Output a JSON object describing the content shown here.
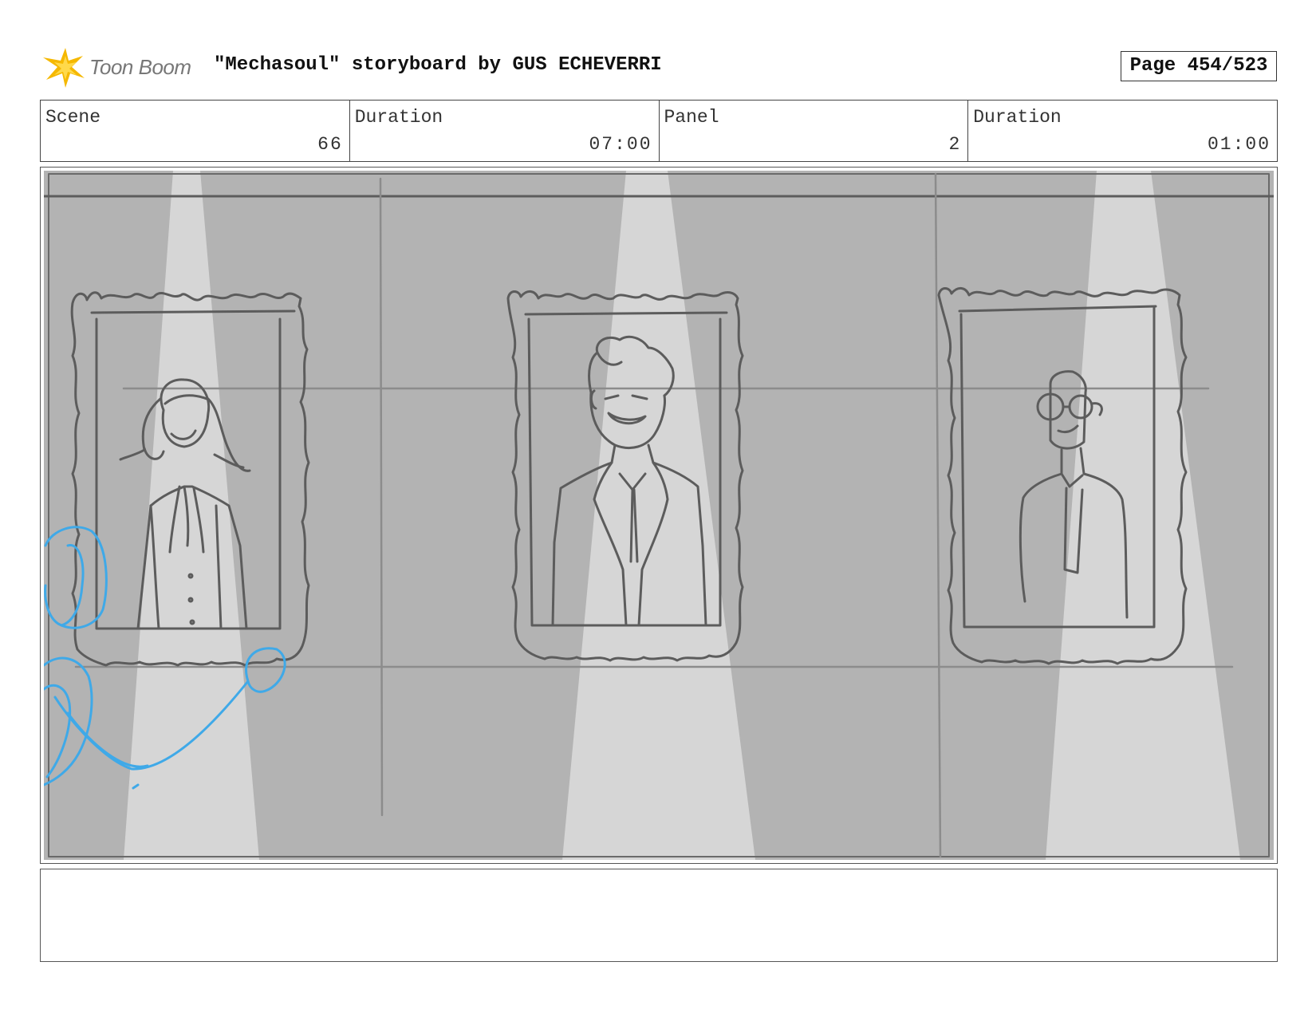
{
  "header": {
    "logo_text": "Toon Boom",
    "title": "\"Mechasoul\" storyboard by GUS ECHEVERRI",
    "page": "Page 454/523"
  },
  "info": {
    "scene_label": "Scene",
    "scene_value": "66",
    "scene_duration_label": "Duration",
    "scene_duration_value": "07:00",
    "panel_label": "Panel",
    "panel_value": "2",
    "panel_duration_label": "Duration",
    "panel_duration_value": "01:00"
  },
  "notes": {
    "text": ""
  },
  "colors": {
    "wall": "#b3b3b3",
    "spotlight": "#d6d6d6",
    "sketch_line": "#5c5c5c",
    "blue_sketch": "#3fa9e8",
    "logo_star": "#f5b800"
  }
}
